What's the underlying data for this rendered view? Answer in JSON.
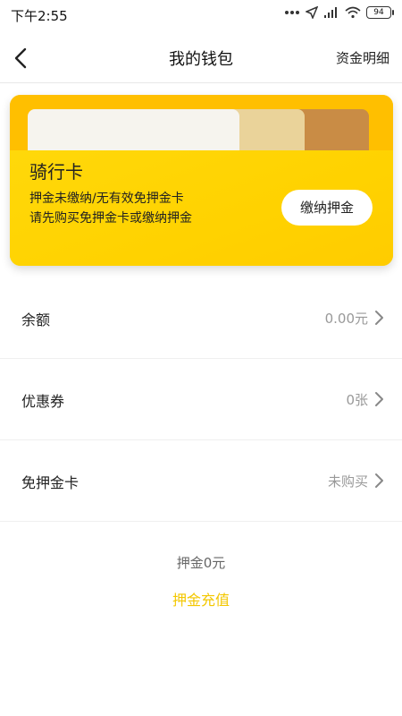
{
  "status_bar": {
    "time": "下午2:55",
    "battery": "94"
  },
  "nav": {
    "title": "我的钱包",
    "right_action": "资金明细"
  },
  "card": {
    "title": "骑行卡",
    "line1": "押金未缴纳/无有效免押金卡",
    "line2": "请先购买免押金卡或缴纳押金",
    "button": "缴纳押金"
  },
  "list": [
    {
      "label": "余额",
      "value": "0.00元"
    },
    {
      "label": "优惠券",
      "value": "0张"
    },
    {
      "label": "免押金卡",
      "value": "未购买"
    }
  ],
  "deposit_text": "押金0元",
  "recharge_link": "押金充值",
  "colors": {
    "accent": "#ffcc00",
    "link": "#f3c700"
  }
}
